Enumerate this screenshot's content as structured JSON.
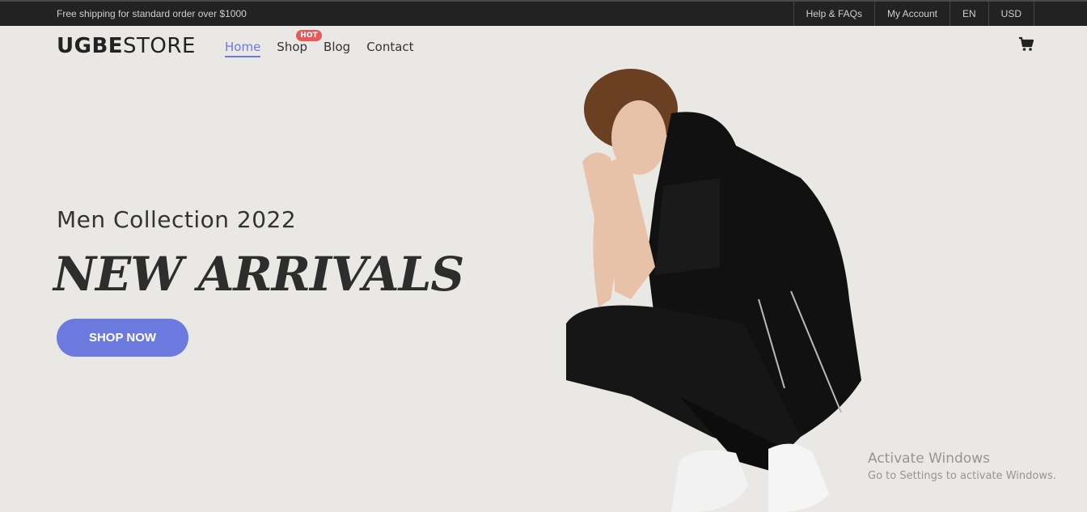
{
  "topbar": {
    "promo": "Free shipping for standard order over $1000",
    "links": [
      "Help & FAQs",
      "My Account",
      "EN",
      "USD"
    ]
  },
  "header": {
    "logo_bold": "UGBE",
    "logo_light": "STORE",
    "nav": [
      {
        "label": "Home",
        "active": true
      },
      {
        "label": "Shop",
        "badge": "HOT"
      },
      {
        "label": "Blog"
      },
      {
        "label": "Contact"
      }
    ],
    "cart_icon": "cart-icon"
  },
  "hero": {
    "subtitle": "Men Collection 2022",
    "headline": "NEW ARRIVALS",
    "cta": "SHOP NOW"
  },
  "watermark": {
    "title": "Activate Windows",
    "subtitle": "Go to Settings to activate Windows."
  },
  "colors": {
    "accent": "#6c7ae0",
    "badge": "#e65a5a",
    "topbar_bg": "#222222",
    "page_bg": "#e9e8e4"
  }
}
